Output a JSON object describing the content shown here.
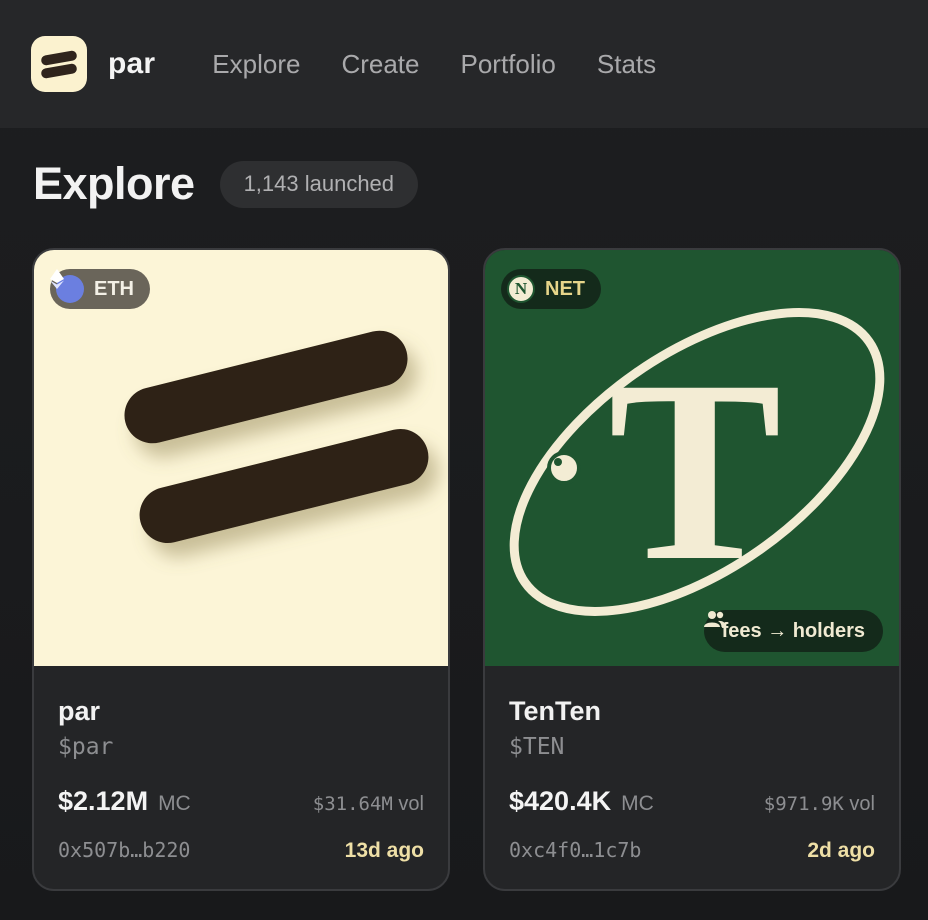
{
  "header": {
    "brand": "par",
    "nav": [
      "Explore",
      "Create",
      "Portfolio",
      "Stats"
    ]
  },
  "main": {
    "title": "Explore",
    "count": "1,143 launched"
  },
  "cards": [
    {
      "chain": "ETH",
      "chain_icon": "ethereum-icon",
      "image": "par-logo-image",
      "name": "par",
      "symbol": "$par",
      "market_cap": "$2.12M",
      "mc_unit": "MC",
      "volume": "$31.64M",
      "vol_unit": "vol",
      "address": "0x507b…b220",
      "age": "13d ago",
      "bg_color": "#fcf5d7"
    },
    {
      "chain": "NET",
      "chain_icon": "net-icon",
      "chain_icon_letter": "N",
      "image": "tenten-logo-image",
      "image_letter": "T",
      "fees_label": "fees → holders",
      "fees_icon": "users-icon",
      "name": "TenTen",
      "symbol": "$TEN",
      "market_cap": "$420.4K",
      "mc_unit": "MC",
      "volume": "$971.9K",
      "vol_unit": "vol",
      "address": "0xc4f0…1c7b",
      "age": "2d ago",
      "bg_color": "#1f5530"
    }
  ],
  "colors": {
    "accent_cream": "#fcf5d7",
    "accent_gold": "#eedfa6",
    "brand_brown": "#2f241c",
    "tenten_green": "#1f5530"
  }
}
